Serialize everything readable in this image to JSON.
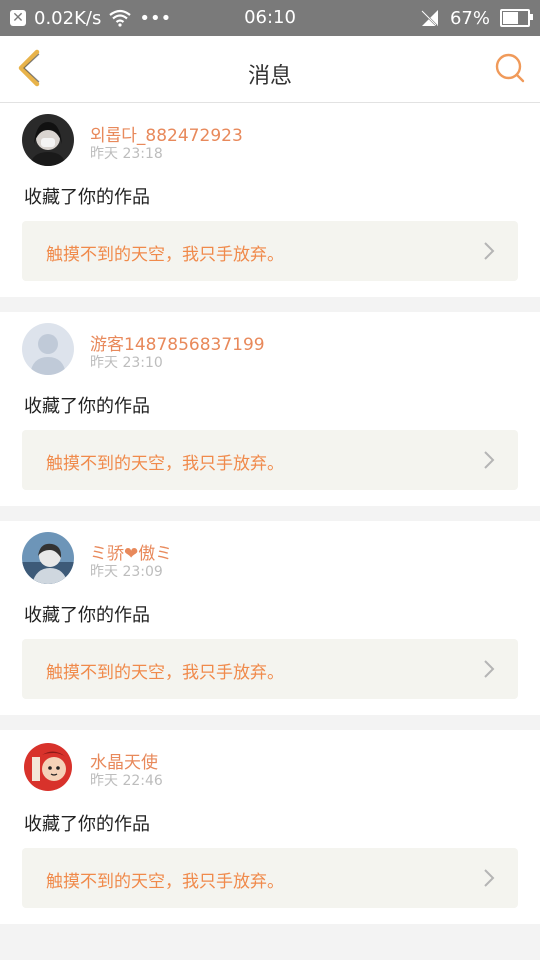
{
  "status_bar": {
    "speed": "0.02K/s",
    "more": "•••",
    "time": "06:10",
    "battery": "67%",
    "battery_level": 0.67
  },
  "header": {
    "title": "消息"
  },
  "messages": [
    {
      "username": "외롭다_882472923",
      "time": "昨天 23:18",
      "action": "收藏了你的作品",
      "work_title": "触摸不到的天空，我只手放弃。"
    },
    {
      "username": "游客1487856837199",
      "time": "昨天 23:10",
      "action": "收藏了你的作品",
      "work_title": "触摸不到的天空，我只手放弃。"
    },
    {
      "username": "ミ骄❤傲ミ",
      "time": "昨天 23:09",
      "action": "收藏了你的作品",
      "work_title": "触摸不到的天空，我只手放弃。"
    },
    {
      "username": "水晶天使",
      "time": "昨天 22:46",
      "action": "收藏了你的作品",
      "work_title": "触摸不到的天空，我只手放弃。"
    }
  ],
  "colors": {
    "accent": "#e8895b",
    "back_icon": "#e8b34a"
  }
}
